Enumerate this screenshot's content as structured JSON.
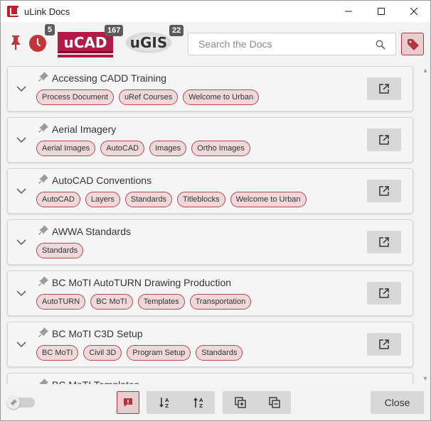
{
  "window": {
    "title": "uLink Docs",
    "minimize_icon": "minimize-icon",
    "maximize_icon": "maximize-icon",
    "close_icon": "close-icon"
  },
  "header": {
    "pinned_count": "5",
    "ucad_label": "uCAD",
    "ucad_count": "167",
    "ugis_label": "uGIS",
    "ugis_count": "22",
    "search_placeholder": "Search the Docs",
    "accent_color": "#b41a48"
  },
  "docs": [
    {
      "title": "Accessing CADD Training",
      "tags": [
        "Process Document",
        "uRef Courses",
        "Welcome to Urban"
      ]
    },
    {
      "title": "Aerial Imagery",
      "tags": [
        "Aerial Images",
        "AutoCAD",
        "Images",
        "Ortho Images"
      ]
    },
    {
      "title": "AutoCAD Conventions",
      "tags": [
        "AutoCAD",
        "Layers",
        "Standards",
        "Titleblocks",
        "Welcome to Urban"
      ]
    },
    {
      "title": "AWWA Standards",
      "tags": [
        "Standards"
      ]
    },
    {
      "title": "BC MoTI AutoTURN Drawing Production",
      "tags": [
        "AutoTURN",
        "BC MoTI",
        "Templates",
        "Transportation"
      ]
    },
    {
      "title": "BC MoTI C3D Setup",
      "tags": [
        "BC MoTI",
        "Civil 3D",
        "Program Setup",
        "Standards"
      ]
    },
    {
      "title": "BC MoTI Templates",
      "tags": []
    }
  ],
  "footer": {
    "close_label": "Close"
  }
}
